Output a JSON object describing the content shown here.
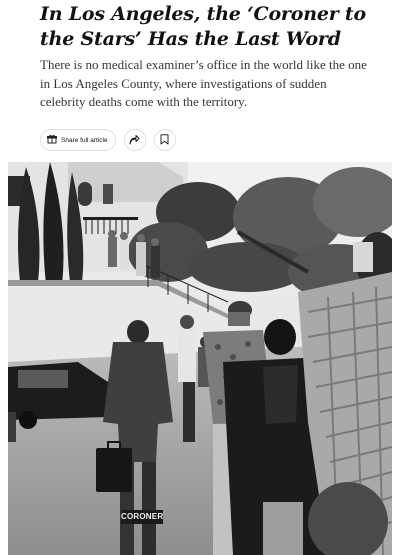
{
  "article": {
    "headline": "In Los Angeles, the ‘Coroner to the Stars’ Has the Last Word",
    "summary": "There is no medical examiner’s office in the world like the one in Los Angeles County, where investigations of sudden celebrity deaths come with the territory."
  },
  "toolbar": {
    "share_full_label": "Share full article",
    "share_icon": "share-arrow-icon",
    "save_icon": "bookmark-icon"
  },
  "photo": {
    "jacket_text": "CORONER"
  }
}
